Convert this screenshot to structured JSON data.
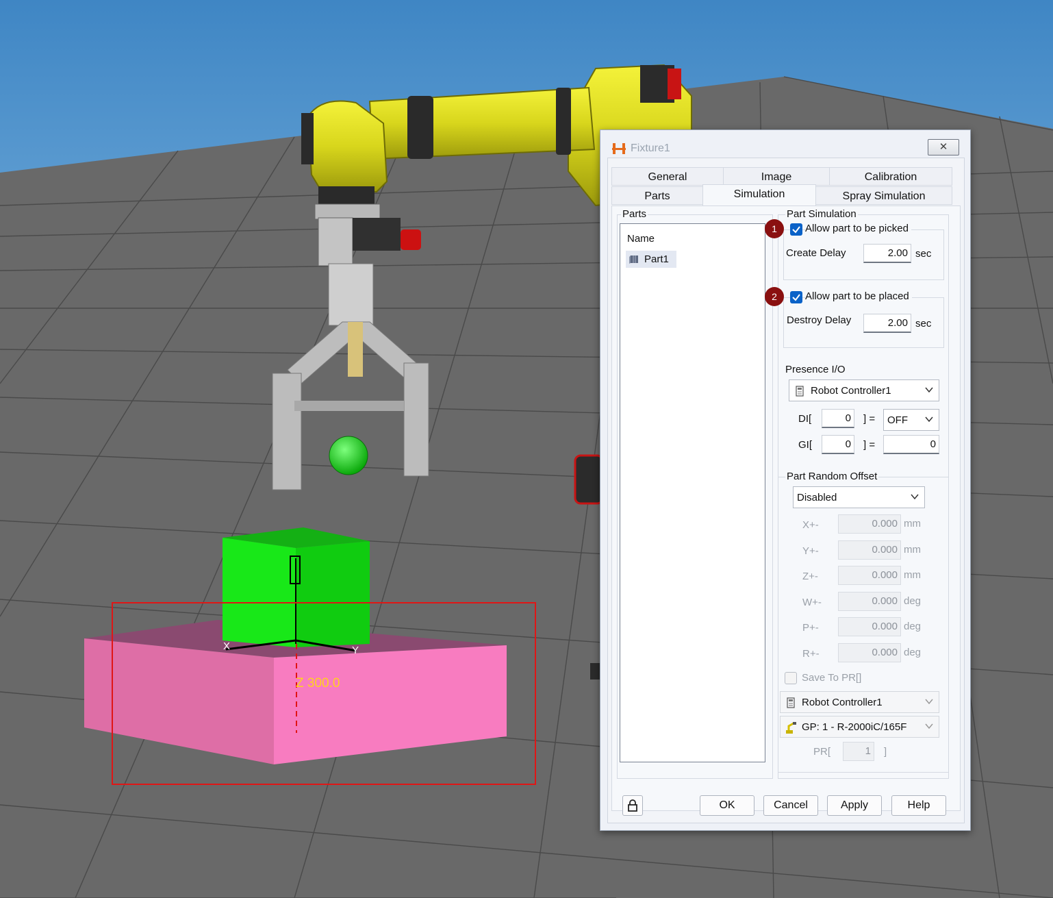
{
  "scene": {
    "dimension_label": "Z 300.0",
    "axis_x": "X",
    "axis_y": "Y"
  },
  "dialog": {
    "title": "Fixture1",
    "tabs_row1": [
      "General",
      "Image",
      "Calibration"
    ],
    "tabs_row2": [
      "Parts",
      "Simulation",
      "Spray Simulation"
    ],
    "active_tab": "Simulation",
    "parts_group": "Parts",
    "parts_header": "Name",
    "parts": [
      "Part1"
    ],
    "sim_group": "Part Simulation",
    "badge1": "1",
    "badge2": "2",
    "allow_picked": "Allow part to be picked",
    "create_delay_label": "Create Delay",
    "create_delay": "2.00",
    "allow_placed": "Allow part to be placed",
    "destroy_delay_label": "Destroy Delay",
    "destroy_delay": "2.00",
    "sec": "sec",
    "presence_label": "Presence I/O",
    "presence_controller": "Robot Controller1",
    "di_label": "DI[",
    "di_value": "0",
    "bracket_eq": "] =",
    "di_state": "OFF",
    "gi_label": "GI[",
    "gi_value": "0",
    "gi_result": "0",
    "random_group": "Part Random Offset",
    "random_mode": "Disabled",
    "offsets": [
      {
        "label": "X+-",
        "value": "0.000",
        "unit": "mm"
      },
      {
        "label": "Y+-",
        "value": "0.000",
        "unit": "mm"
      },
      {
        "label": "Z+-",
        "value": "0.000",
        "unit": "mm"
      },
      {
        "label": "W+-",
        "value": "0.000",
        "unit": "deg"
      },
      {
        "label": "P+-",
        "value": "0.000",
        "unit": "deg"
      },
      {
        "label": "R+-",
        "value": "0.000",
        "unit": "deg"
      }
    ],
    "save_pr": "Save To PR[]",
    "save_controller": "Robot Controller1",
    "group_robot": "GP: 1 - R-2000iC/165F",
    "pr_label": "PR[",
    "pr_value": "1",
    "pr_close": "]",
    "buttons": {
      "ok": "OK",
      "cancel": "Cancel",
      "apply": "Apply",
      "help": "Help"
    }
  }
}
